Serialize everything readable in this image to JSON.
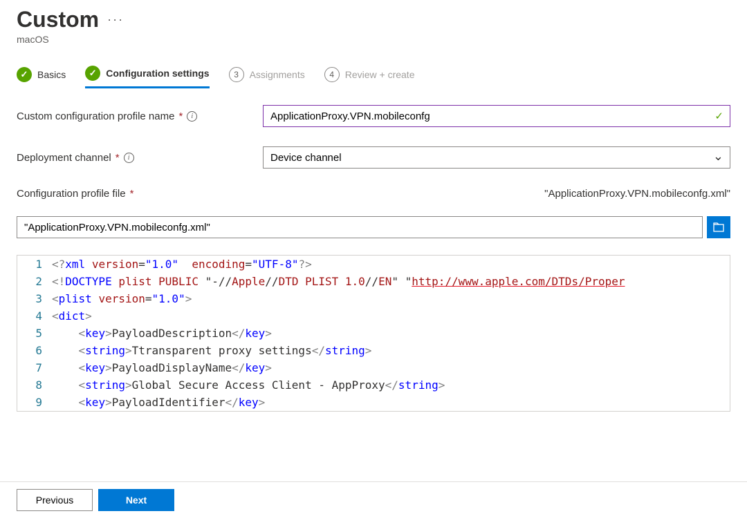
{
  "header": {
    "title": "Custom",
    "subtitle": "macOS"
  },
  "wizard": {
    "steps": [
      {
        "label": "Basics",
        "status": "done"
      },
      {
        "label": "Configuration settings",
        "status": "active"
      },
      {
        "label": "Assignments",
        "num": "3",
        "status": "pending"
      },
      {
        "label": "Review + create",
        "num": "4",
        "status": "pending"
      }
    ]
  },
  "form": {
    "profile_name_label": "Custom configuration profile name",
    "profile_name_value": "ApplicationProxy.VPN.mobileconfg",
    "deploy_label": "Deployment channel",
    "deploy_value": "Device channel",
    "file_label": "Configuration profile file",
    "file_name_display": "\"ApplicationProxy.VPN.mobileconfg.xml\"",
    "file_path_value": "\"ApplicationProxy.VPN.mobileconfg.xml\""
  },
  "code": {
    "lines": [
      {
        "num": "1",
        "html": "<span class='c-gray'>&lt;?</span><span class='c-blue'>xml</span> <span class='c-red'>version</span><span class='c-pun'>=</span><span class='c-blue'>\"1.0\"</span>  <span class='c-red'>encoding</span><span class='c-pun'>=</span><span class='c-blue'>\"UTF-8\"</span><span class='c-gray'>?&gt;</span>"
      },
      {
        "num": "2",
        "html": "<span class='c-gray'>&lt;!</span><span class='c-blue'>DOCTYPE</span> <span class='c-red'>plist</span> <span class='c-red'>PUBLIC</span> <span class='c-pun'>\"-//</span><span class='c-red'>Apple</span><span class='c-pun'>//</span><span class='c-red'>DTD PLIST 1.0</span><span class='c-pun'>//</span><span class='c-red'>EN</span><span class='c-pun'>\"</span> <span class='c-pun'>\"</span><span class='c-link'>http://www.apple.com/DTDs/Proper</span>"
      },
      {
        "num": "3",
        "html": "<span class='c-gray'>&lt;</span><span class='c-blue'>plist</span> <span class='c-red'>version</span><span class='c-pun'>=</span><span class='c-blue'>\"1.0\"</span><span class='c-gray'>&gt;</span>"
      },
      {
        "num": "4",
        "html": "<span class='c-gray'>&lt;</span><span class='c-blue'>dict</span><span class='c-gray'>&gt;</span>"
      },
      {
        "num": "5",
        "html": "    <span class='c-gray'>&lt;</span><span class='c-blue'>key</span><span class='c-gray'>&gt;</span>PayloadDescription<span class='c-gray'>&lt;/</span><span class='c-blue'>key</span><span class='c-gray'>&gt;</span>"
      },
      {
        "num": "6",
        "html": "    <span class='c-gray'>&lt;</span><span class='c-blue'>string</span><span class='c-gray'>&gt;</span>Ttransparent proxy settings<span class='c-gray'>&lt;/</span><span class='c-blue'>string</span><span class='c-gray'>&gt;</span>"
      },
      {
        "num": "7",
        "html": "    <span class='c-gray'>&lt;</span><span class='c-blue'>key</span><span class='c-gray'>&gt;</span>PayloadDisplayName<span class='c-gray'>&lt;/</span><span class='c-blue'>key</span><span class='c-gray'>&gt;</span>"
      },
      {
        "num": "8",
        "html": "    <span class='c-gray'>&lt;</span><span class='c-blue'>string</span><span class='c-gray'>&gt;</span>Global Secure Access Client - AppProxy<span class='c-gray'>&lt;/</span><span class='c-blue'>string</span><span class='c-gray'>&gt;</span>"
      },
      {
        "num": "9",
        "html": "    <span class='c-gray'>&lt;</span><span class='c-blue'>key</span><span class='c-gray'>&gt;</span>PayloadIdentifier<span class='c-gray'>&lt;/</span><span class='c-blue'>key</span><span class='c-gray'>&gt;</span>"
      }
    ]
  },
  "footer": {
    "previous": "Previous",
    "next": "Next"
  }
}
